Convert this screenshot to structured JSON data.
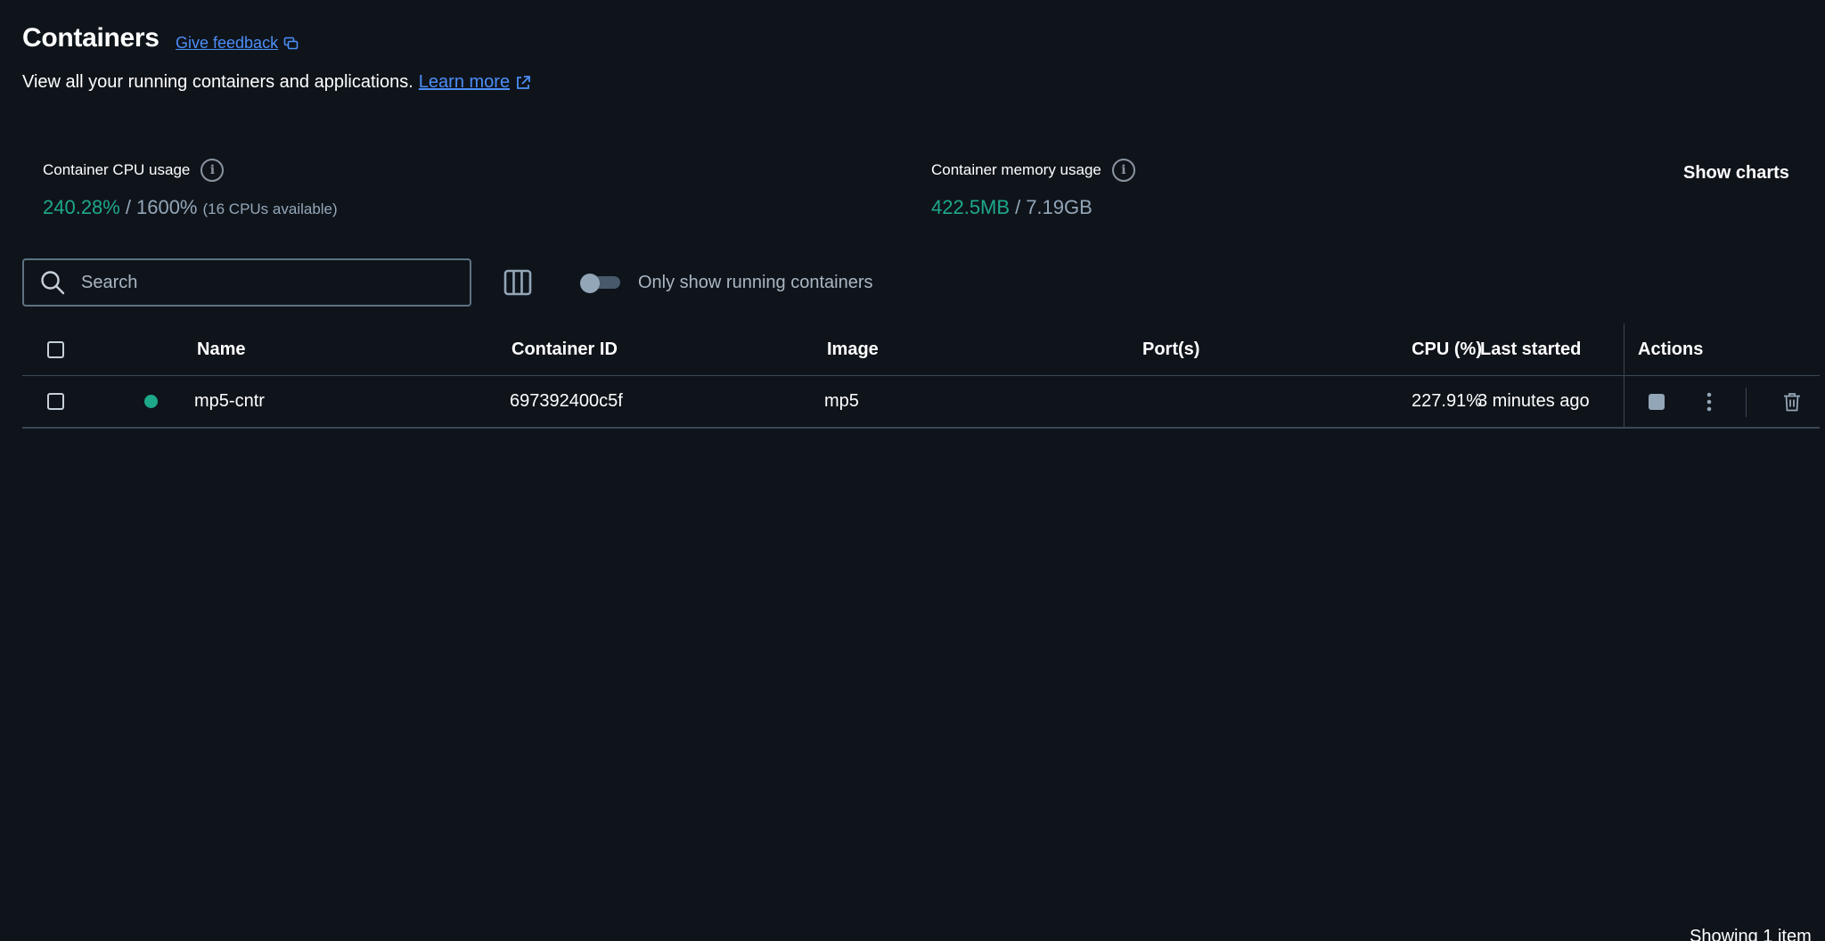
{
  "header": {
    "title": "Containers",
    "feedback_label": "Give feedback",
    "subtitle": "View all your running containers and applications.",
    "learn_more_label": "Learn more"
  },
  "stats": {
    "cpu": {
      "label": "Container CPU usage",
      "used": "240.28%",
      "separator": "/",
      "total": "1600%",
      "note": "(16 CPUs available)"
    },
    "memory": {
      "label": "Container memory usage",
      "used": "422.5MB",
      "separator": "/",
      "total": "7.19GB"
    },
    "show_charts_label": "Show charts"
  },
  "toolbar": {
    "search_placeholder": "Search",
    "toggle_label": "Only show running containers",
    "toggle_on": false
  },
  "table": {
    "columns": {
      "name": "Name",
      "container_id": "Container ID",
      "image": "Image",
      "ports": "Port(s)",
      "cpu": "CPU (%)",
      "last_started": "Last started",
      "actions": "Actions"
    },
    "rows": [
      {
        "status": "running",
        "name": "mp5-cntr",
        "container_id": "697392400c5f",
        "image": "mp5",
        "ports": "",
        "cpu": "227.91%",
        "last_started": "3 minutes ago"
      }
    ]
  },
  "footer": {
    "count_label": "Showing 1 item"
  },
  "colors": {
    "background": "#0f141b",
    "accent_green": "#1ea88a",
    "link_blue": "#4d8ef7",
    "muted": "#93a6b8"
  },
  "icons": [
    "external-link-icon",
    "info-icon",
    "search-icon",
    "columns-icon",
    "stop-icon",
    "more-vertical-icon",
    "trash-icon"
  ]
}
